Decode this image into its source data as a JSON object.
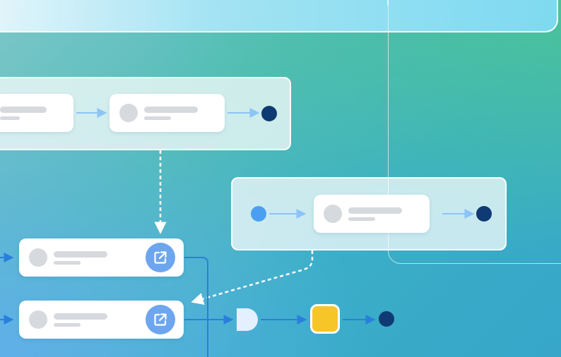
{
  "colors": {
    "end_node": "#0f3a73",
    "start_node": "#4c9ff0",
    "action_icon": "#6da6ee",
    "gate": "#e4efff",
    "task": "#f6c628",
    "connector_light": "#8cc4f6",
    "connector_dark": "#2a7fdc",
    "dashed_connector": "#ffffff"
  },
  "icons": {
    "external_link": "external-link-icon"
  },
  "groups": [
    {
      "id": "group-a",
      "items": [
        "step",
        "step",
        "end"
      ]
    },
    {
      "id": "group-b",
      "items": [
        "start",
        "step",
        "end"
      ]
    }
  ],
  "flow": [
    {
      "id": "flow-node-1",
      "icon": "external-link-icon"
    },
    {
      "id": "flow-node-2",
      "icon": "external-link-icon"
    },
    {
      "id": "gate",
      "icon": "and-gate-icon"
    },
    {
      "id": "task",
      "icon": "task-square-icon"
    },
    {
      "id": "end",
      "icon": "end-dot-icon"
    }
  ]
}
